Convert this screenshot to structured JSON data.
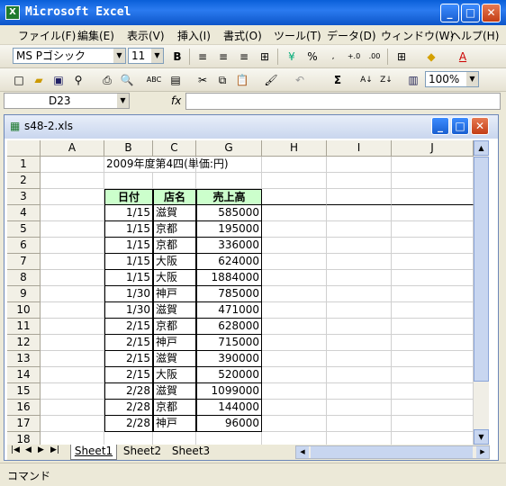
{
  "app": {
    "title": "Microsoft Excel"
  },
  "menu": [
    "ファイル(F)",
    "編集(E)",
    "表示(V)",
    "挿入(I)",
    "書式(O)",
    "ツール(T)",
    "データ(D)",
    "ウィンドウ(W)",
    "ヘルプ(H)"
  ],
  "format_toolbar": {
    "font": "MS Pゴシック",
    "size": "11"
  },
  "standard_toolbar": {
    "zoom": "100%"
  },
  "formula_bar": {
    "name_box": "D23",
    "fx": "fx",
    "value": ""
  },
  "workbook": {
    "title": "s48-2.xls"
  },
  "columns": [
    "A",
    "B",
    "C",
    "G",
    "H",
    "I",
    "J"
  ],
  "rows": [
    "1",
    "2",
    "3",
    "4",
    "5",
    "6",
    "7",
    "8",
    "9",
    "10",
    "11",
    "12",
    "13",
    "14",
    "15",
    "16",
    "17",
    "18"
  ],
  "sheet": {
    "title_cell": "2009年度第4四(単価:円)",
    "headers": [
      "日付",
      "店名",
      "売上高"
    ],
    "header_color": "#ccffcc",
    "data": [
      [
        "1/15",
        "滋賀",
        "585000"
      ],
      [
        "1/15",
        "京都",
        "195000"
      ],
      [
        "1/15",
        "京都",
        "336000"
      ],
      [
        "1/15",
        "大阪",
        "624000"
      ],
      [
        "1/15",
        "大阪",
        "1884000"
      ],
      [
        "1/30",
        "神戸",
        "785000"
      ],
      [
        "1/30",
        "滋賀",
        "471000"
      ],
      [
        "2/15",
        "京都",
        "628000"
      ],
      [
        "2/15",
        "神戸",
        "715000"
      ],
      [
        "2/15",
        "滋賀",
        "390000"
      ],
      [
        "2/15",
        "大阪",
        "520000"
      ],
      [
        "2/28",
        "滋賀",
        "1099000"
      ],
      [
        "2/28",
        "京都",
        "144000"
      ],
      [
        "2/28",
        "神戸",
        "96000"
      ]
    ]
  },
  "tabs": [
    "Sheet1",
    "Sheet2",
    "Sheet3"
  ],
  "status": {
    "mode": "コマンド"
  }
}
